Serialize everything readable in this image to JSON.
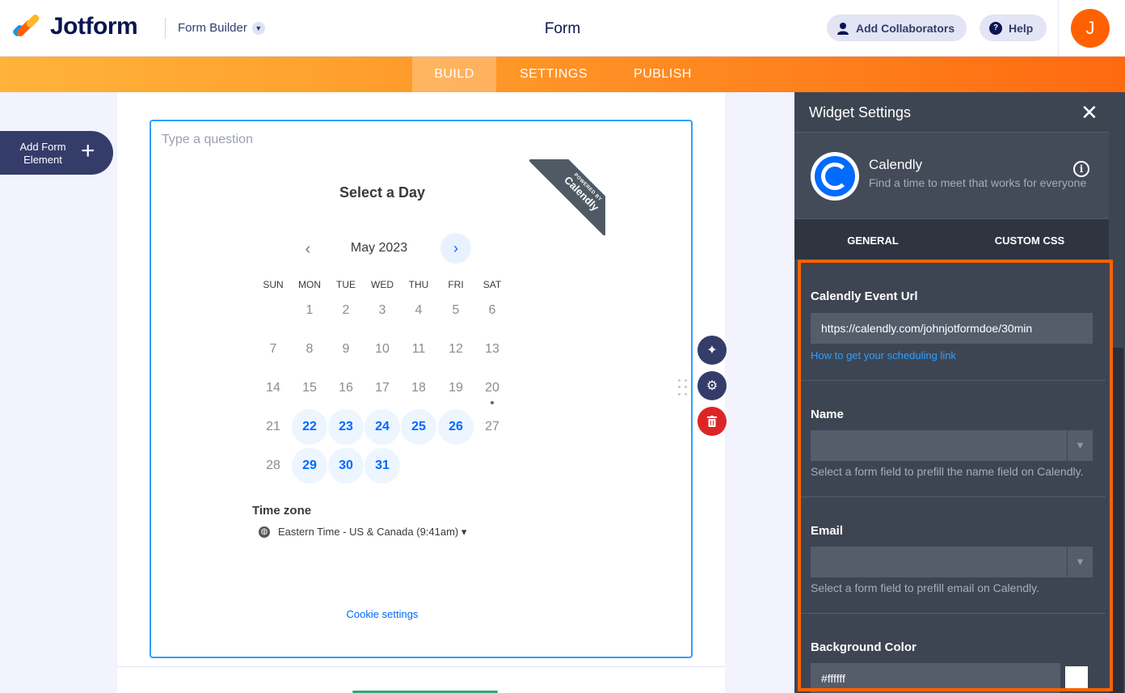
{
  "header": {
    "brand": "Jotform",
    "builder_label": "Form Builder",
    "title": "Form",
    "collaborators_label": "Add Collaborators",
    "help_label": "Help",
    "avatar_initial": "J"
  },
  "nav": {
    "tabs": [
      {
        "label": "BUILD",
        "active": true
      },
      {
        "label": "SETTINGS",
        "active": false
      },
      {
        "label": "PUBLISH",
        "active": false
      }
    ]
  },
  "left": {
    "add_element_line1": "Add Form",
    "add_element_line2": "Element"
  },
  "question": {
    "placeholder": "Type a question"
  },
  "calendly_widget": {
    "heading": "Select a Day",
    "ribbon_small": "POWERED BY",
    "ribbon_big": "Calendly",
    "month": "May 2023",
    "weekdays": [
      "SUN",
      "MON",
      "TUE",
      "WED",
      "THU",
      "FRI",
      "SAT"
    ],
    "weeks": [
      [
        "",
        "1",
        "2",
        "3",
        "4",
        "5",
        "6"
      ],
      [
        "7",
        "8",
        "9",
        "10",
        "11",
        "12",
        "13"
      ],
      [
        "14",
        "15",
        "16",
        "17",
        "18",
        "19",
        "20"
      ],
      [
        "21",
        "22",
        "23",
        "24",
        "25",
        "26",
        "27"
      ],
      [
        "28",
        "29",
        "30",
        "31",
        "",
        "",
        ""
      ]
    ],
    "available_days": [
      "22",
      "23",
      "24",
      "25",
      "26",
      "29",
      "30",
      "31"
    ],
    "today": "20",
    "timezone_label": "Time zone",
    "timezone_value": "Eastern Time - US & Canada (9:41am) ▾",
    "cookie_link": "Cookie settings"
  },
  "panel": {
    "title": "Widget Settings",
    "widget_name": "Calendly",
    "widget_desc": "Find a time to meet that works for everyone",
    "tabs": [
      "GENERAL",
      "CUSTOM CSS"
    ],
    "fields": {
      "event_url_label": "Calendly Event Url",
      "event_url_value": "https://calendly.com/johnjotformdoe/30min",
      "event_url_help": "How to get your scheduling link",
      "name_label": "Name",
      "name_help": "Select a form field to prefill the name field on Calendly.",
      "email_label": "Email",
      "email_help": "Select a form field to prefill email on Calendly.",
      "bg_label": "Background Color",
      "bg_value": "#ffffff"
    }
  },
  "colors": {
    "accent": "#ff6100",
    "brand_navy": "#0a1551",
    "calendly_blue": "#0069ff",
    "panel_bg": "#3e4552"
  }
}
